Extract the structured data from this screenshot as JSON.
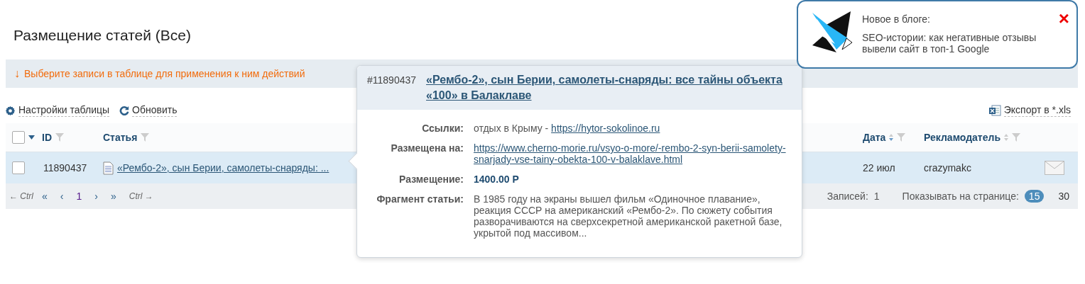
{
  "page_title": "Размещение статей (Все)",
  "notice": {
    "arrow": "↓",
    "text": "Выберите записи в таблице для применения к ним действий"
  },
  "toolbar": {
    "settings": "Настройки таблицы",
    "refresh": "Обновить",
    "export": "Экспорт в *.xls"
  },
  "table": {
    "header_checked": false,
    "columns": [
      {
        "label": "ID",
        "kind": "filter"
      },
      {
        "label": "Статья",
        "kind": "filter"
      },
      {
        "label": "Дата",
        "kind": "sort-filter"
      },
      {
        "label": "Рекламодатель",
        "kind": "sort-filter"
      }
    ],
    "rows": [
      {
        "checked": false,
        "id": "11890437",
        "article": "«Рембо-2», сын Берии, самолеты-снаряды: ...",
        "date": "22 июл",
        "advertiser": "crazymakc"
      }
    ]
  },
  "pager": {
    "prev_hint": "← Ctrl",
    "first": "«",
    "prev": "‹",
    "next": "›",
    "last": "»",
    "next_hint": "Ctrl →",
    "pages": [
      {
        "label": "1",
        "selected": true
      }
    ],
    "records_label": "Записей:",
    "records": "1",
    "per_page_label": "Показывать на странице:",
    "per_page": [
      {
        "label": "15",
        "selected": true
      },
      {
        "label": "30",
        "selected": false
      }
    ]
  },
  "popup": {
    "id": "#11890437",
    "title": "«Рембо-2», сын Берии, самолеты-снаряды: все тайны объекта «100» в Балаклаве",
    "fields": [
      {
        "kind": "anchor",
        "label": "Ссылки:",
        "text": "отдых в Крыму - ",
        "link": "https://hytor-sokolinoe.ru"
      },
      {
        "kind": "link",
        "label": "Размещена на:",
        "link": "https://www.cherno-morie.ru/vsyo-o-more/-rembo-2-syn-berii-samolety-snarjady-vse-tainy-obekta-100-v-balaklave.html"
      },
      {
        "kind": "price",
        "label": "Размещение:",
        "text": "1400.00 Р"
      },
      {
        "kind": "text",
        "label": "Фрагмент статьи:",
        "text": "В 1985 году на экраны вышел фильм «Одиночное плавание», реакция СССР на американский «Рембо-2». По сюжету события разворачиваются на сверхсекретной американской ракетной базе, укрытой под массивом..."
      }
    ]
  },
  "notification": {
    "heading": "Новое в блоге:",
    "text": "SEO-истории: как негативные отзывы вывели сайт в топ-1 Google",
    "close": "×"
  }
}
